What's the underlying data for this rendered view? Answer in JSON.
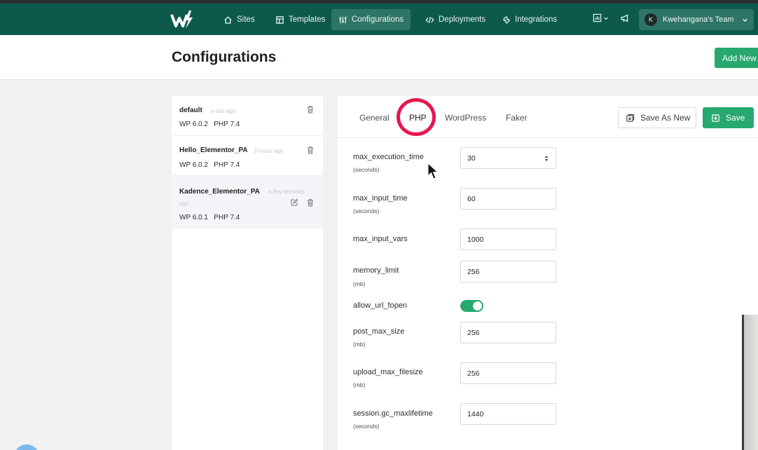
{
  "nav": {
    "items": [
      {
        "label": "Sites",
        "icon": "home-icon",
        "active": false
      },
      {
        "label": "Templates",
        "icon": "template-icon",
        "active": false
      },
      {
        "label": "Configurations",
        "icon": "sliders-icon",
        "active": true
      },
      {
        "label": "Deployments",
        "icon": "code-icon",
        "active": false
      },
      {
        "label": "Integrations",
        "icon": "puzzle-icon",
        "active": false
      }
    ],
    "team": {
      "initial": "K",
      "name": "Kwehangana's Team"
    }
  },
  "header": {
    "title": "Configurations",
    "add_new": "Add New"
  },
  "configs": [
    {
      "name": "default",
      "time": "a day ago",
      "wp": "WP 6.0.2",
      "php": "PHP 7.4",
      "selected": false
    },
    {
      "name": "Hello_Elementor_PA",
      "time": "3 hours ago",
      "wp": "WP 6.0.2",
      "php": "PHP 7.4",
      "selected": false
    },
    {
      "name": "Kadence_Elementor_PA",
      "time": "a few seconds",
      "time2": "ago",
      "wp": "WP 6.0.1",
      "php": "PHP 7.4",
      "selected": true
    }
  ],
  "tabs": [
    {
      "label": "General"
    },
    {
      "label": "PHP",
      "active": true
    },
    {
      "label": "WordPress"
    },
    {
      "label": "Faker"
    }
  ],
  "actions": {
    "save_as_new": "Save As New",
    "save": "Save"
  },
  "fields": [
    {
      "label": "max_execution_time",
      "unit": "(seconds)",
      "value": "30",
      "type": "number"
    },
    {
      "label": "max_input_time",
      "unit": "(seconds)",
      "value": "60"
    },
    {
      "label": "max_input_vars",
      "unit": "",
      "value": "1000"
    },
    {
      "label": "memory_limit",
      "unit": "(mb)",
      "value": "256"
    },
    {
      "label": "allow_url_fopen",
      "unit": "",
      "toggle": true
    },
    {
      "label": "post_max_size",
      "unit": "(mb)",
      "value": "256"
    },
    {
      "label": "upload_max_filesize",
      "unit": "(mb)",
      "value": "256"
    },
    {
      "label": "session.gc_maxlifetime",
      "unit": "(seconds)",
      "value": "1440"
    }
  ],
  "colors": {
    "nav_bg": "#0d5a4c",
    "accent": "#26a86e",
    "highlight": "#e8174f"
  }
}
